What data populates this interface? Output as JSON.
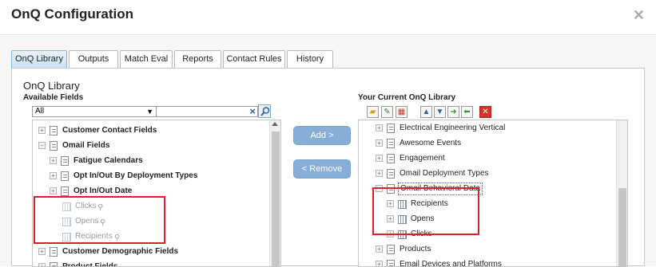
{
  "dialog": {
    "title": "OnQ Configuration"
  },
  "tabs": [
    "OnQ Library",
    "Outputs",
    "Match Eval",
    "Reports",
    "Contact Rules",
    "History"
  ],
  "panel": {
    "title": "OnQ Library",
    "available_fields_label": "Available Fields",
    "select_value": "All",
    "search_value": ""
  },
  "left_tree": {
    "customer_contact_fields": "Customer Contact Fields",
    "omail_fields": "Omail Fields",
    "fatigue_calendars": "Fatigue Calendars",
    "opt_in_out_deployment_types": "Opt In/Out By Deployment Types",
    "opt_in_out_date": "Opt In/Out Date",
    "clicks": "Clicks",
    "opens": "Opens",
    "recipients": "Recipients",
    "customer_demographic_fields": "Customer Demographic Fields",
    "product_fields": "Product Fields"
  },
  "buttons": {
    "add": "Add >",
    "remove": "< Remove"
  },
  "right": {
    "title": "Your Current OnQ Library",
    "tree": {
      "electrical_engineering": "Electrical Engineering Vertical",
      "awesome_events": "Awesome Events",
      "engagement": "Engagement",
      "omail_deployment_types": "Omail Deployment Types",
      "omail_behavioral_data": "Omail Behavioral Data",
      "recipients": "Recipients",
      "opens": "Opens",
      "clicks": "Clicks",
      "products": "Products",
      "email_devices_platforms": "Email Devices and Platforms"
    }
  },
  "colors": {
    "highlight": "#d9202b",
    "button_blue": "#86aed6",
    "tab_active": "#c9dff5"
  }
}
